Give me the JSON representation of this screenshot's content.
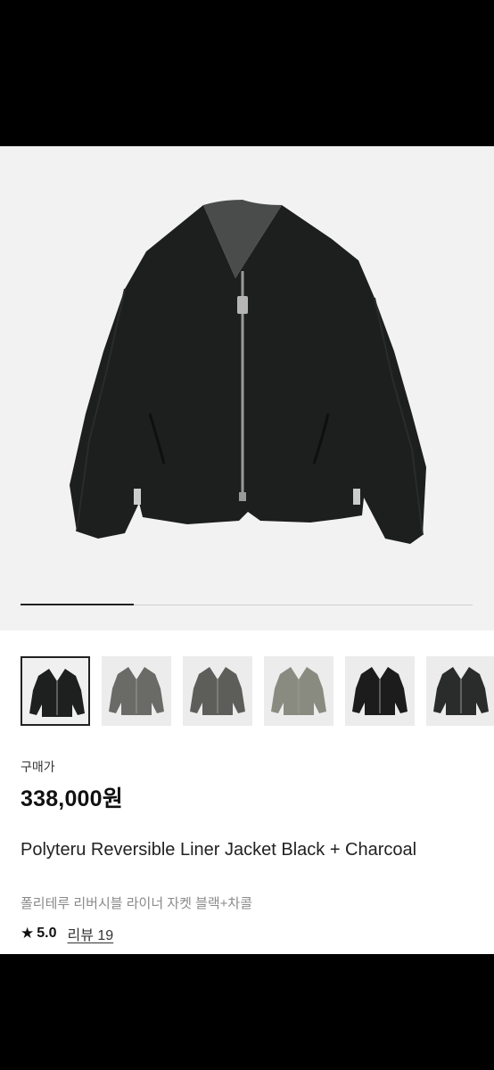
{
  "product": {
    "price_label": "구매가",
    "price": "338,000원",
    "title": "Polyteru Reversible Liner Jacket Black + Charcoal",
    "subtitle": "폴리테루 리버시블 라이너 자켓 블랙+차콜",
    "rating": "5.0",
    "reviews_link": "리뷰 19"
  },
  "gallery": {
    "progress": 0.25,
    "main_image": "black-zip-liner-jacket",
    "thumbnails": [
      {
        "name": "black-jacket",
        "color": "#1e1f1f",
        "selected": true
      },
      {
        "name": "charcoal-quilted-jacket",
        "color": "#6a6a66",
        "selected": false
      },
      {
        "name": "charcoal-quilted-jacket-alt",
        "color": "#5d5e59",
        "selected": false
      },
      {
        "name": "khaki-quilted-jacket",
        "color": "#8a8b80",
        "selected": false
      },
      {
        "name": "black-jacket-worn",
        "color": "#1c1c1c",
        "selected": false
      },
      {
        "name": "black-jacket-worn-alt",
        "color": "#2a2c2b",
        "selected": false
      }
    ]
  },
  "icons": {
    "rating": "star-icon"
  },
  "colors": {
    "text": "#111111",
    "muted": "#8a8a8a",
    "hero_bg": "#f2f2f2"
  }
}
